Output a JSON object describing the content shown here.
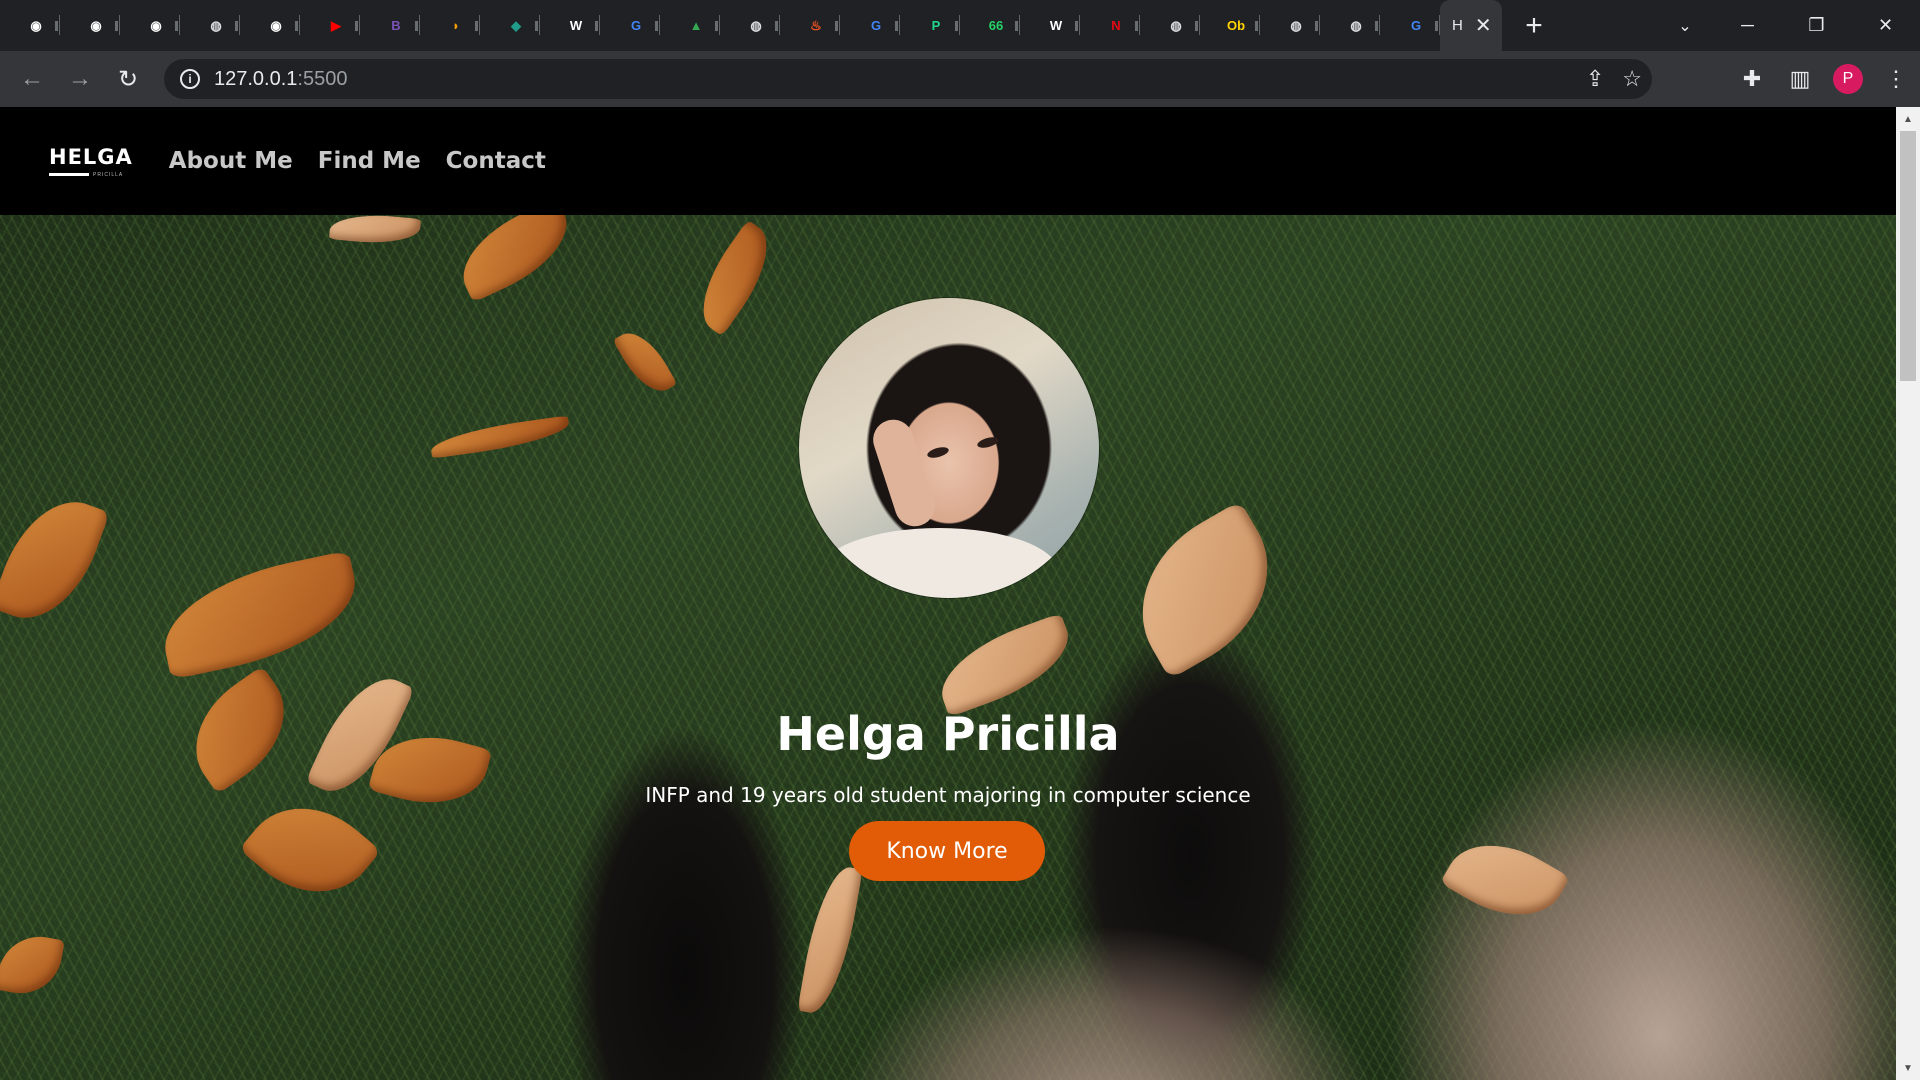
{
  "browser": {
    "tabs": [
      {
        "icon": "github-icon",
        "glyph": "◉",
        "color": "#ffffff"
      },
      {
        "icon": "github-icon",
        "glyph": "◉",
        "color": "#ffffff"
      },
      {
        "icon": "github-icon",
        "glyph": "◉",
        "color": "#ffffff"
      },
      {
        "icon": "globe-icon",
        "glyph": "◍",
        "color": "#dadce0"
      },
      {
        "icon": "github-icon",
        "glyph": "◉",
        "color": "#ffffff"
      },
      {
        "icon": "youtube-icon",
        "glyph": "▶",
        "color": "#ff0000"
      },
      {
        "icon": "bootstrap-icon",
        "glyph": "B",
        "color": "#7952b3"
      },
      {
        "icon": "codepen-icon",
        "glyph": "◗",
        "color": "#f59e0b"
      },
      {
        "icon": "site-icon",
        "glyph": "◆",
        "color": "#1f9d8a"
      },
      {
        "icon": "wikipedia-icon",
        "glyph": "W",
        "color": "#ffffff"
      },
      {
        "icon": "google-icon",
        "glyph": "G",
        "color": "#4285f4"
      },
      {
        "icon": "drive-icon",
        "glyph": "▲",
        "color": "#34a853"
      },
      {
        "icon": "globe-icon",
        "glyph": "◍",
        "color": "#dadce0"
      },
      {
        "icon": "fire-icon",
        "glyph": "♨",
        "color": "#ff5722"
      },
      {
        "icon": "google-icon",
        "glyph": "G",
        "color": "#4285f4"
      },
      {
        "icon": "pycharm-icon",
        "glyph": "P",
        "color": "#21d789"
      },
      {
        "icon": "whatsapp-icon",
        "glyph": "66",
        "color": "#25d366"
      },
      {
        "icon": "wikipedia-icon",
        "glyph": "W",
        "color": "#ffffff"
      },
      {
        "icon": "netflix-icon",
        "glyph": "N",
        "color": "#e50914"
      },
      {
        "icon": "globe-icon",
        "glyph": "◍",
        "color": "#dadce0"
      },
      {
        "icon": "site-icon",
        "glyph": "Ob",
        "color": "#ffd400"
      },
      {
        "icon": "globe-icon",
        "glyph": "◍",
        "color": "#dadce0"
      },
      {
        "icon": "globe-icon",
        "glyph": "◍",
        "color": "#dadce0"
      },
      {
        "icon": "google-icon",
        "glyph": "G",
        "color": "#4285f4"
      }
    ],
    "active_tab": {
      "title": "H",
      "close": "✕"
    },
    "new_tab": "+",
    "url_host": "127.0.0.1",
    "url_port": ":5500",
    "profile_initial": "P"
  },
  "site": {
    "logo": "HELGA",
    "logo_sub": "PRICILLA",
    "nav": [
      "About Me",
      "Find Me",
      "Contact"
    ],
    "hero": {
      "name": "Helga Pricilla",
      "tagline": "INFP and 19 years old student majoring in computer science",
      "cta": "Know More"
    }
  },
  "colors": {
    "accent": "#e25c07",
    "nav_bg": "#000000",
    "chrome_bg": "#202124"
  }
}
